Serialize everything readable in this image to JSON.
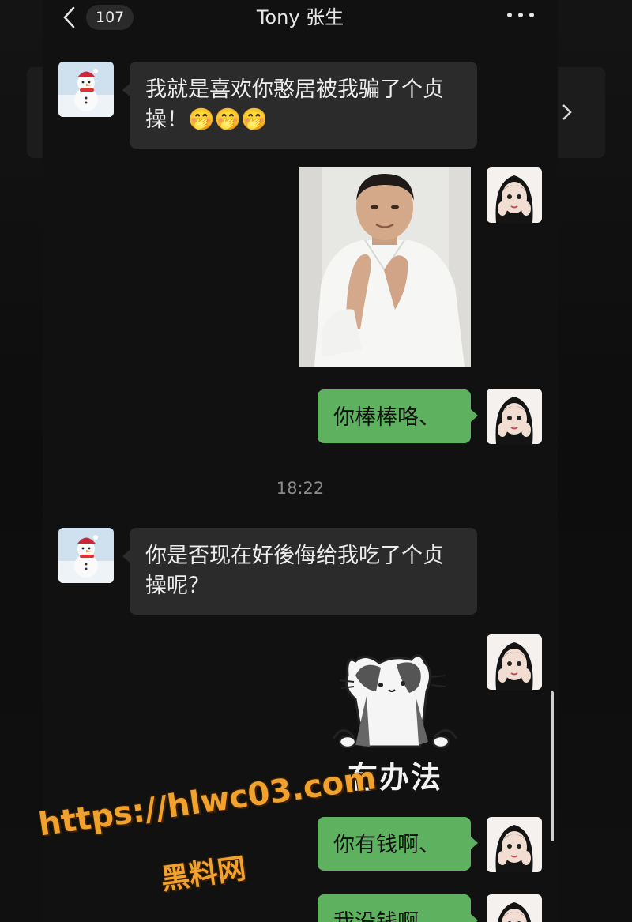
{
  "header": {
    "back_icon": "chevron-left-icon",
    "unread_count": "107",
    "title": "Tony 张生",
    "more_icon": "ellipsis-icon"
  },
  "messages": [
    {
      "side": "in",
      "type": "text",
      "text": "我就是喜欢你憨居被我骗了个贞操！🤭🤭🤭"
    },
    {
      "side": "out",
      "type": "image"
    },
    {
      "side": "out",
      "type": "text",
      "text": "你棒棒咯、"
    },
    {
      "type": "timestamp",
      "text": "18:22"
    },
    {
      "side": "in",
      "type": "text",
      "text": "你是否现在好後侮给我吃了个贞操呢？"
    },
    {
      "side": "out",
      "type": "sticker",
      "caption": "冇办法"
    },
    {
      "side": "out",
      "type": "text",
      "text": "你有钱啊、"
    },
    {
      "side": "out",
      "type": "text",
      "text": "我没钱啊、"
    }
  ],
  "watermark": {
    "url": "https://hlwc03.com",
    "name": "黑料网"
  },
  "colors": {
    "outgoing_bubble": "#5eb15f",
    "incoming_bubble": "#2b2b2b",
    "background": "#111111",
    "watermark": "#f1a12d"
  }
}
